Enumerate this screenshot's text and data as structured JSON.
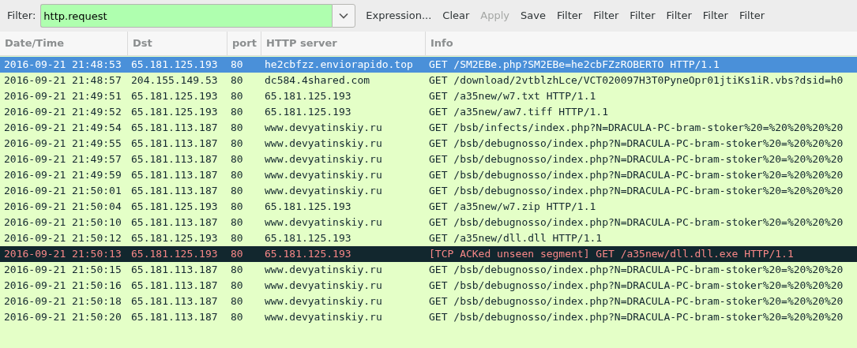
{
  "toolbar": {
    "filter_label": "Filter:",
    "filter": {
      "value": "http.request",
      "valid": true
    },
    "buttons": [
      {
        "label": "Expression...",
        "disabled": false
      },
      {
        "label": "Clear",
        "disabled": false
      },
      {
        "label": "Apply",
        "disabled": true
      },
      {
        "label": "Save",
        "disabled": false
      },
      {
        "label": "Filter",
        "disabled": false
      },
      {
        "label": "Filter",
        "disabled": false
      },
      {
        "label": "Filter",
        "disabled": false
      },
      {
        "label": "Filter",
        "disabled": false
      },
      {
        "label": "Filter",
        "disabled": false
      },
      {
        "label": "Filter",
        "disabled": false
      }
    ]
  },
  "table": {
    "columns": [
      "Date/Time",
      "Dst",
      "port",
      "HTTP server",
      "Info"
    ],
    "rows": [
      {
        "selected": true,
        "kind": "normal",
        "cells": [
          "2016-09-21 21:48:53",
          "65.181.125.193",
          "80",
          "he2cbfzz.enviorapido.top",
          "GET /SM2EBe.php?SM2EBe=he2cbFZzROBERTO HTTP/1.1"
        ]
      },
      {
        "selected": false,
        "kind": "normal",
        "cells": [
          "2016-09-21 21:48:57",
          "204.155.149.53",
          "80",
          "dc584.4shared.com",
          "GET /download/2vtblzhLce/VCT020097H3T0PyneOpr01jtiKs1iR.vbs?dsid=h0"
        ]
      },
      {
        "selected": false,
        "kind": "normal",
        "cells": [
          "2016-09-21 21:49:51",
          "65.181.125.193",
          "80",
          "65.181.125.193",
          "GET /a35new/w7.txt HTTP/1.1"
        ]
      },
      {
        "selected": false,
        "kind": "normal",
        "cells": [
          "2016-09-21 21:49:52",
          "65.181.125.193",
          "80",
          "65.181.125.193",
          "GET /a35new/aw7.tiff HTTP/1.1"
        ]
      },
      {
        "selected": false,
        "kind": "normal",
        "cells": [
          "2016-09-21 21:49:54",
          "65.181.113.187",
          "80",
          "www.devyatinskiy.ru",
          "GET /bsb/infects/index.php?N=DRACULA-PC-bram-stoker%20=%20%20%20%20"
        ]
      },
      {
        "selected": false,
        "kind": "normal",
        "cells": [
          "2016-09-21 21:49:55",
          "65.181.113.187",
          "80",
          "www.devyatinskiy.ru",
          "GET /bsb/debugnosso/index.php?N=DRACULA-PC-bram-stoker%20=%20%20%20"
        ]
      },
      {
        "selected": false,
        "kind": "normal",
        "cells": [
          "2016-09-21 21:49:57",
          "65.181.113.187",
          "80",
          "www.devyatinskiy.ru",
          "GET /bsb/debugnosso/index.php?N=DRACULA-PC-bram-stoker%20=%20%20%20"
        ]
      },
      {
        "selected": false,
        "kind": "normal",
        "cells": [
          "2016-09-21 21:49:59",
          "65.181.113.187",
          "80",
          "www.devyatinskiy.ru",
          "GET /bsb/debugnosso/index.php?N=DRACULA-PC-bram-stoker%20=%20%20%20"
        ]
      },
      {
        "selected": false,
        "kind": "normal",
        "cells": [
          "2016-09-21 21:50:01",
          "65.181.113.187",
          "80",
          "www.devyatinskiy.ru",
          "GET /bsb/debugnosso/index.php?N=DRACULA-PC-bram-stoker%20=%20%20%20"
        ]
      },
      {
        "selected": false,
        "kind": "normal",
        "cells": [
          "2016-09-21 21:50:04",
          "65.181.125.193",
          "80",
          "65.181.125.193",
          "GET /a35new/w7.zip HTTP/1.1"
        ]
      },
      {
        "selected": false,
        "kind": "normal",
        "cells": [
          "2016-09-21 21:50:10",
          "65.181.113.187",
          "80",
          "www.devyatinskiy.ru",
          "GET /bsb/debugnosso/index.php?N=DRACULA-PC-bram-stoker%20=%20%20%20"
        ]
      },
      {
        "selected": false,
        "kind": "normal",
        "cells": [
          "2016-09-21 21:50:12",
          "65.181.125.193",
          "80",
          "65.181.125.193",
          "GET /a35new/dll.dll HTTP/1.1"
        ]
      },
      {
        "selected": false,
        "kind": "bad",
        "cells": [
          "2016-09-21 21:50:13",
          "65.181.125.193",
          "80",
          "65.181.125.193",
          "[TCP ACKed unseen segment] GET /a35new/dll.dll.exe HTTP/1.1"
        ]
      },
      {
        "selected": false,
        "kind": "normal",
        "cells": [
          "2016-09-21 21:50:15",
          "65.181.113.187",
          "80",
          "www.devyatinskiy.ru",
          "GET /bsb/debugnosso/index.php?N=DRACULA-PC-bram-stoker%20=%20%20%20"
        ]
      },
      {
        "selected": false,
        "kind": "normal",
        "cells": [
          "2016-09-21 21:50:16",
          "65.181.113.187",
          "80",
          "www.devyatinskiy.ru",
          "GET /bsb/debugnosso/index.php?N=DRACULA-PC-bram-stoker%20=%20%20%20"
        ]
      },
      {
        "selected": false,
        "kind": "normal",
        "cells": [
          "2016-09-21 21:50:18",
          "65.181.113.187",
          "80",
          "www.devyatinskiy.ru",
          "GET /bsb/debugnosso/index.php?N=DRACULA-PC-bram-stoker%20=%20%20%20"
        ]
      },
      {
        "selected": false,
        "kind": "normal",
        "cells": [
          "2016-09-21 21:50:20",
          "65.181.113.187",
          "80",
          "www.devyatinskiy.ru",
          "GET /bsb/debugnosso/index.php?N=DRACULA-PC-bram-stoker%20=%20%20%20"
        ]
      }
    ]
  }
}
